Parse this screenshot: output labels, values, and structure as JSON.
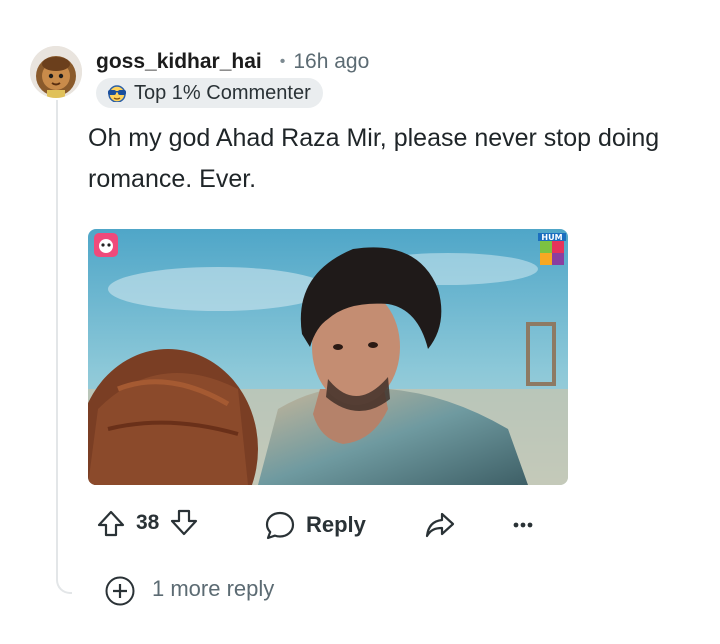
{
  "comment": {
    "username": "goss_kidhar_hai",
    "separator": "•",
    "timestamp": "16h ago",
    "badge": {
      "icon": "sunglasses-icon",
      "label": "Top 1% Commenter"
    },
    "body": "Oh my god Ahad Raza Mir, please never stop doing romance. Ever."
  },
  "media": {
    "app_icon": "panda-icon",
    "channel_logo": "hum-tv-logo",
    "watermark_text": "HUM"
  },
  "actions": {
    "vote_count": "38",
    "reply_label": "Reply",
    "more_menu": "more-options-icon"
  },
  "more_replies": {
    "label": "1 more reply"
  },
  "colors": {
    "badge_bg": "#eaedef",
    "thread_line": "#e3e6e8",
    "muted_text": "#5c6b73"
  }
}
